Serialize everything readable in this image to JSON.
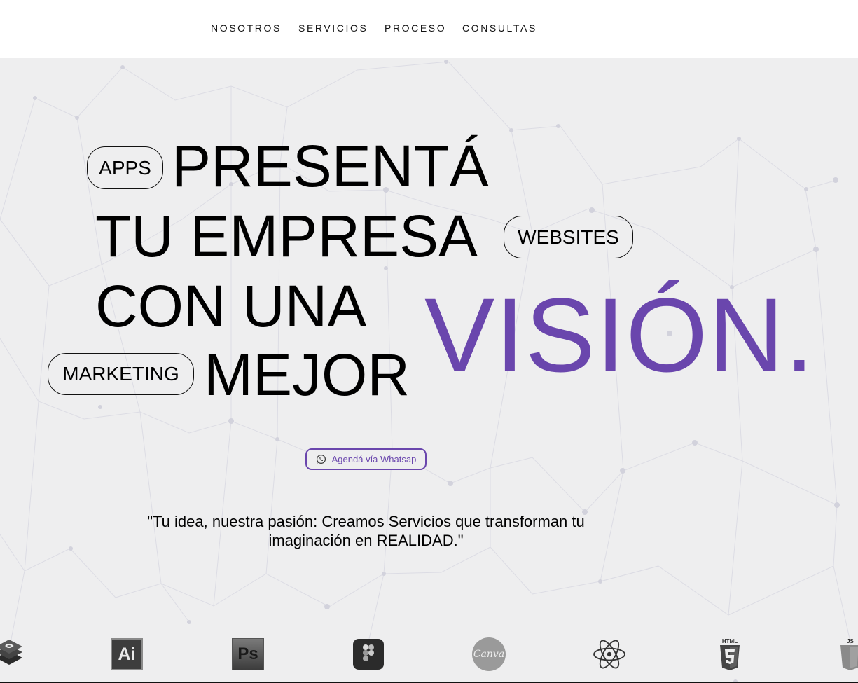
{
  "nav": {
    "items": [
      {
        "label": "NOSOTROS"
      },
      {
        "label": "SERVICIOS"
      },
      {
        "label": "PROCESO"
      },
      {
        "label": "CONSULTAS"
      }
    ]
  },
  "hero": {
    "line1": "PRESENTÁ",
    "line2": "TU EMPRESA",
    "line3": "CON UNA",
    "line4": "MEJOR",
    "highlight": "VISIÓN.",
    "tags": {
      "apps": "APPS",
      "websites": "WEBSITES",
      "marketing": "MARKETING"
    },
    "cta_label": "Agendá vía Whatsap",
    "quote": "\"Tu idea, nuestra pasión: Creamos Servicios que transforman tu imaginación en REALIDAD.\""
  },
  "logos": {
    "html5_text": "HTML",
    "js_text": "JS",
    "canva_text": "Canva",
    "ai_text": "Ai",
    "ps_text": "Ps",
    "items": [
      "bootstrap-icon",
      "illustrator-icon",
      "photoshop-icon",
      "figma-icon",
      "canva-icon",
      "react-icon",
      "html5-icon",
      "javascript-icon"
    ]
  },
  "colors": {
    "accent": "#6a46ad",
    "hero_bg": "#eeeeef",
    "text": "#000000"
  }
}
